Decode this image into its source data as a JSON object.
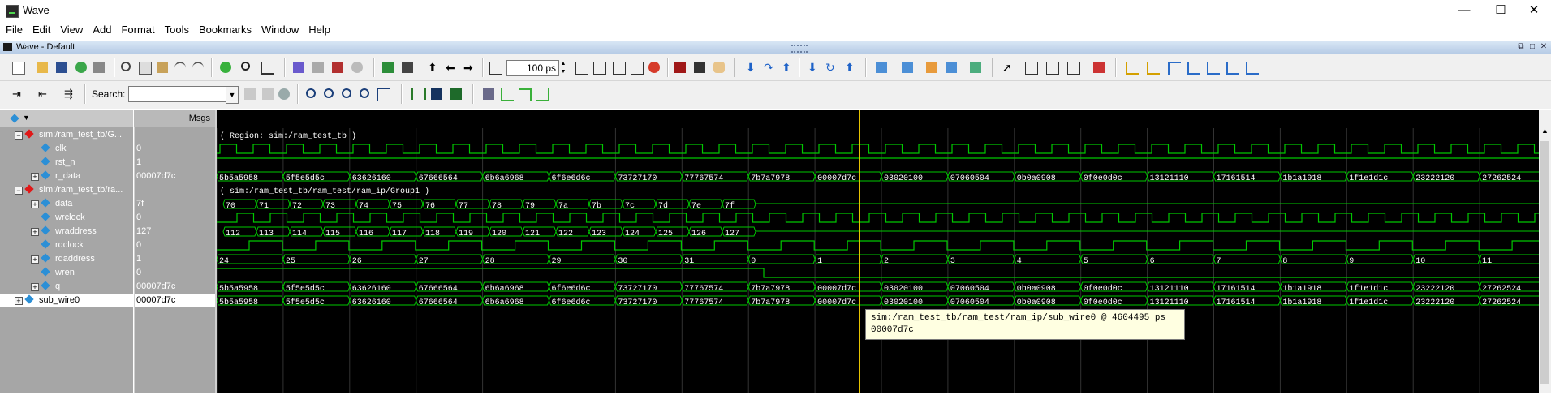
{
  "window": {
    "title": "Wave",
    "minimize": "—",
    "maximize": "☐",
    "close": "✕"
  },
  "menu": [
    "File",
    "Edit",
    "View",
    "Add",
    "Format",
    "Tools",
    "Bookmarks",
    "Window",
    "Help"
  ],
  "panel": {
    "title": "Wave - Default"
  },
  "toolbar": {
    "search_label": "Search:",
    "search_value": "",
    "time_value": "100 ps"
  },
  "headers": {
    "msgs": "Msgs"
  },
  "signals": [
    {
      "name": "sim:/ram_test_tb/G...",
      "value": "",
      "level": 0,
      "type": "group",
      "expand": "−"
    },
    {
      "name": "clk",
      "value": "0",
      "level": 1,
      "type": "bit"
    },
    {
      "name": "rst_n",
      "value": "1",
      "level": 1,
      "type": "bit"
    },
    {
      "name": "r_data",
      "value": "00007d7c",
      "level": 1,
      "type": "bus",
      "expand": "+"
    },
    {
      "name": "sim:/ram_test_tb/ra...",
      "value": "",
      "level": 0,
      "type": "group",
      "expand": "−"
    },
    {
      "name": "data",
      "value": "7f",
      "level": 1,
      "type": "bus",
      "expand": "+"
    },
    {
      "name": "wrclock",
      "value": "0",
      "level": 1,
      "type": "bit"
    },
    {
      "name": "wraddress",
      "value": "127",
      "level": 1,
      "type": "bus",
      "expand": "+"
    },
    {
      "name": "rdclock",
      "value": "0",
      "level": 1,
      "type": "bit"
    },
    {
      "name": "rdaddress",
      "value": "1",
      "level": 1,
      "type": "bus",
      "expand": "+"
    },
    {
      "name": "wren",
      "value": "0",
      "level": 1,
      "type": "bit"
    },
    {
      "name": "q",
      "value": "00007d7c",
      "level": 1,
      "type": "bus",
      "expand": "+"
    },
    {
      "name": "sub_wire0",
      "value": "00007d7c",
      "level": 0,
      "type": "bus",
      "expand": "+",
      "selected": true
    }
  ],
  "regions": [
    "( Region: sim:/ram_test_tb )",
    "( sim:/ram_test_tb/ram_test/ram_ip/Group1 )"
  ],
  "bus_values": {
    "data_labels": [
      "r_data",
      "q",
      "sub_wire0"
    ],
    "data": [
      "5b5a5958",
      "5f5e5d5c",
      "63626160",
      "67666564",
      "6b6a6968",
      "6f6e6d6c",
      "73727170",
      "77767574",
      "7b7a7978",
      "00007d7c",
      "03020100",
      "07060504",
      "0b0a0908",
      "0f0e0d0c",
      "13121110",
      "17161514",
      "1b1a1918",
      "1f1e1d1c",
      "23222120",
      "27262524"
    ],
    "wdata": [
      "70",
      "71",
      "72",
      "73",
      "74",
      "75",
      "76",
      "77",
      "78",
      "79",
      "7a",
      "7b",
      "7c",
      "7d",
      "7e",
      "7f"
    ],
    "wraddr": [
      "112",
      "113",
      "114",
      "115",
      "116",
      "117",
      "118",
      "119",
      "120",
      "121",
      "122",
      "123",
      "124",
      "125",
      "126",
      "127"
    ],
    "rdaddr": [
      "24",
      "25",
      "26",
      "27",
      "28",
      "29",
      "30",
      "31",
      "0",
      "1",
      "2",
      "3",
      "4",
      "5",
      "6",
      "7",
      "8",
      "9",
      "10",
      "11"
    ]
  },
  "tooltip": {
    "line1": "sim:/ram_test_tb/ram_test/ram_ip/sub_wire0 @ 4604495 ps",
    "line2": "00007d7c"
  },
  "colors": {
    "wave": "#00c800",
    "cursor": "#e6c300",
    "text": "#ffffff",
    "grid": "#333333",
    "diamond": "#e01818",
    "sig": "#2b8fd6"
  }
}
